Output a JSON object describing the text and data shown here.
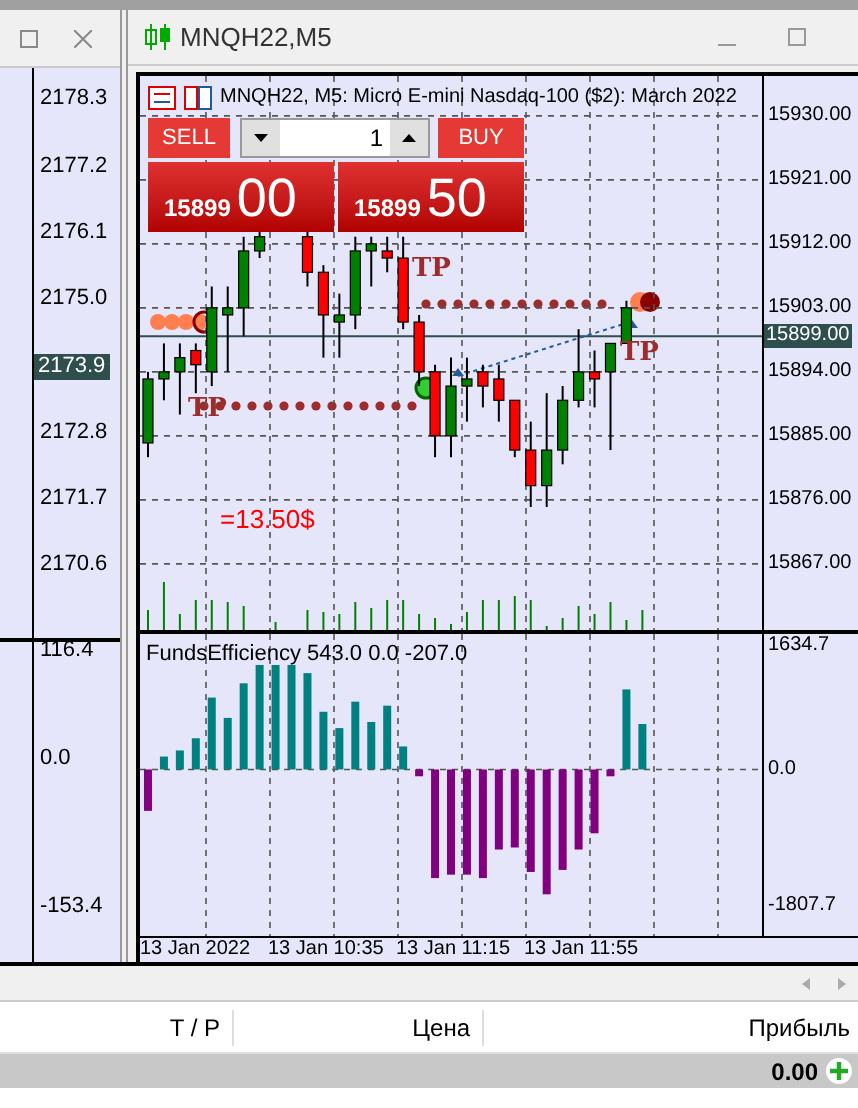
{
  "left_window": {
    "price_axis": [
      {
        "label": "2178.3",
        "current": false
      },
      {
        "label": "2177.2",
        "current": false
      },
      {
        "label": "2176.1",
        "current": false
      },
      {
        "label": "2175.0",
        "current": false
      },
      {
        "label": "2173.9",
        "current": true
      },
      {
        "label": "2172.8",
        "current": false
      },
      {
        "label": "2171.7",
        "current": false
      },
      {
        "label": "2170.6",
        "current": false
      }
    ],
    "indicator_axis": [
      "116.4",
      "0.0",
      "-153.4"
    ]
  },
  "window": {
    "title": "MNQH22,M5"
  },
  "chart": {
    "header": "MNQH22, M5:  Micro E-mini Nasdaq-100 ($2): March 2022",
    "current_price": "15899.00",
    "trade_panel": {
      "sell_label": "SELL",
      "volume": "1",
      "buy_label": "BUY",
      "sell_price": {
        "prefix": "15899",
        "digits": "00"
      },
      "buy_price": {
        "prefix": "15899",
        "digits": "50"
      }
    },
    "annotations": [
      {
        "kind": "tp",
        "text": "TP"
      },
      {
        "kind": "tp",
        "text": "TP"
      },
      {
        "kind": "tp",
        "text": "TP"
      },
      {
        "kind": "profit",
        "text": "=13.50$"
      }
    ],
    "chart_data": {
      "type": "candlestick",
      "grid": true,
      "categories": [
        null,
        null,
        null,
        null,
        null,
        null,
        null,
        null,
        null,
        null,
        null,
        null,
        null,
        null,
        null,
        null,
        null,
        null,
        null,
        null,
        null,
        null,
        null,
        null,
        null,
        null,
        null,
        null,
        null,
        null,
        null,
        null,
        null,
        null,
        null,
        null,
        null,
        null,
        null
      ],
      "ylim": [
        15857.7,
        15935.6
      ],
      "yticks": [
        {
          "value": 15930,
          "label": "15930.00"
        },
        {
          "value": 15921,
          "label": "15921.00"
        },
        {
          "value": 15912,
          "label": "15912.00"
        },
        {
          "value": 15903,
          "label": "15903.00"
        },
        {
          "value": 15894,
          "label": "15894.00"
        },
        {
          "value": 15885,
          "label": "15885.00"
        },
        {
          "value": 15876,
          "label": "15876.00"
        },
        {
          "value": 15867,
          "label": "15867.00"
        }
      ],
      "ohlc": [
        [
          15884,
          15894,
          15882,
          15893
        ],
        [
          15893,
          15898,
          15890,
          15894
        ],
        [
          15894,
          15898,
          15888,
          15896
        ],
        [
          15897,
          15898,
          15891,
          15895
        ],
        [
          15894,
          15906,
          15892,
          15903
        ],
        [
          15902,
          15906,
          15894,
          15903
        ],
        [
          15903,
          15913,
          15899,
          15911
        ],
        [
          15911,
          15914,
          15910,
          15913
        ],
        null,
        null,
        [
          15913,
          15914,
          15906,
          15908
        ],
        [
          15908,
          15909,
          15896,
          15902
        ],
        [
          15901,
          15905,
          15896,
          15902
        ],
        [
          15902,
          15913,
          15900,
          15911
        ],
        [
          15911,
          15913,
          15906,
          15912
        ],
        [
          15911,
          15913,
          15908,
          15910
        ],
        [
          15910,
          15913,
          15900,
          15901
        ],
        [
          15901,
          15902,
          15892,
          15894
        ],
        [
          15894,
          15895,
          15882,
          15885
        ],
        [
          15885,
          15896,
          15882,
          15892
        ],
        [
          15892,
          15896,
          15887,
          15893
        ],
        [
          15894,
          15895,
          15889,
          15892
        ],
        [
          15893,
          15895,
          15887,
          15890
        ],
        [
          15890,
          15890,
          15882,
          15883
        ],
        [
          15883,
          15887,
          15875,
          15878
        ],
        [
          15878,
          15891,
          15875,
          15883
        ],
        [
          15883,
          15892,
          15881,
          15890
        ],
        [
          15890,
          15900,
          15889,
          15894
        ],
        [
          15894,
          15897,
          15889,
          15893
        ],
        [
          15894,
          15898,
          15883,
          15898
        ],
        [
          15898,
          15904,
          15898,
          15903
        ],
        null,
        null,
        null,
        null,
        null,
        null,
        null,
        null
      ]
    }
  },
  "indicator": {
    "chart_data": {
      "type": "bar",
      "title": "FundsEfficiency 543.0 0.0 -207.0",
      "grid": true,
      "categories": [
        null,
        null,
        null,
        null,
        null,
        null,
        null,
        null,
        null,
        null,
        null,
        null,
        null,
        null,
        null,
        null,
        null,
        null,
        null,
        null,
        null,
        null,
        null,
        null,
        null,
        null,
        null,
        null,
        null,
        null,
        null,
        null,
        null,
        null,
        null,
        null,
        null,
        null,
        null
      ],
      "values": [
        -548,
        171,
        252,
        413,
        952,
        683,
        1141,
        1384,
        1384,
        1384,
        1276,
        764,
        548,
        898,
        629,
        845,
        305,
        -90,
        -1438,
        -1393,
        -1393,
        -1438,
        -1060,
        -1033,
        -1357,
        -1653,
        -1330,
        -1060,
        -845,
        -90,
        1060,
        602,
        null,
        null,
        null,
        null,
        null,
        null,
        null
      ],
      "ylim": [
        -2205,
        1794
      ],
      "yticks": [
        {
          "value": 1634.7,
          "label": "1634.7"
        },
        {
          "value": 0,
          "label": "0.0"
        },
        {
          "value": -1807.7,
          "label": "-1807.7"
        }
      ]
    }
  },
  "time_axis": [
    "13 Jan 2022",
    "13 Jan 10:35",
    "13 Jan 11:15",
    "13 Jan 11:55"
  ],
  "positions_table": {
    "columns": [
      "T / P",
      "Цена",
      "Прибыль"
    ],
    "rows": [
      {
        "profit": "0.00"
      }
    ]
  }
}
